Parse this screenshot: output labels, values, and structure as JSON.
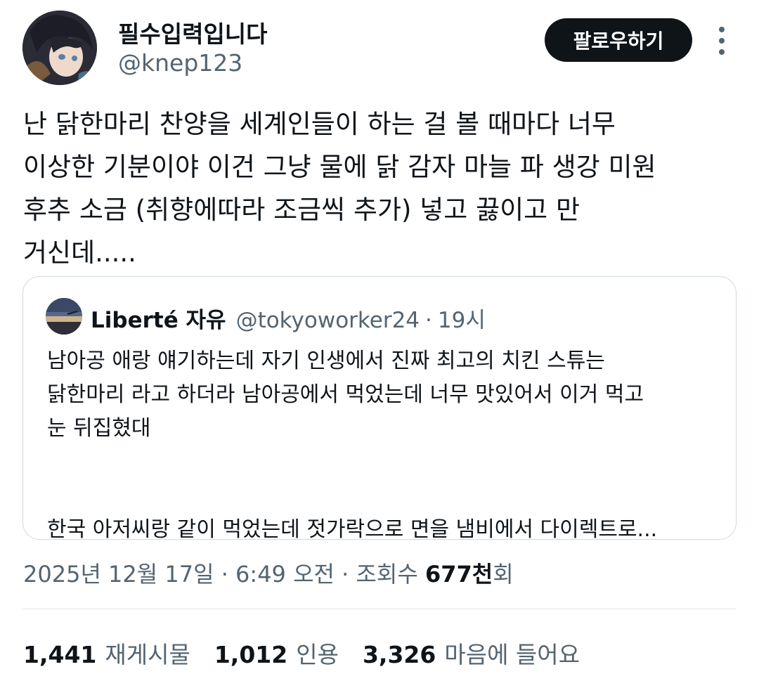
{
  "author": {
    "display_name": "필수입력입니다",
    "handle": "@knep123"
  },
  "actions": {
    "follow_label": "팔로우하기"
  },
  "tweet": {
    "lines": [
      "난 닭한마리 찬양을 세계인들이 하는 걸 볼 때마다 너무",
      "이상한 기분이야 이건 그냥 물에 닭 감자 마늘 파 생강 미원",
      "후추 소금 (취향에따라 조금씩 추가) 넣고 끓이고 만",
      "거신데....."
    ]
  },
  "quote": {
    "name": "Liberté 자유",
    "handle": "@tokyoworker24",
    "separator": "·",
    "time": "19시",
    "lines": [
      "남아공 애랑 얘기하는데 자기 인생에서 진짜 최고의 치킨 스튜는",
      "닭한마리 라고 하더라 남아공에서 먹었는데 너무 맛있어서 이거 먹고",
      "눈 뒤집혔대",
      "한국 아저씨랑 같이 먹었는데 젓가락으로 면을 냄비에서 다이렉트로..."
    ]
  },
  "meta": {
    "timestamp": "2025년 12월 17일 · 6:49 오전 · 조회수 ",
    "views": "677천",
    "views_suffix": "회"
  },
  "stats": {
    "retweets": {
      "count": "1,441",
      "label": "재게시물"
    },
    "quotes": {
      "count": "1,012",
      "label": "인용"
    },
    "likes": {
      "count": "3,326",
      "label": "마음에 들어요"
    }
  },
  "colors": {
    "text_primary": "#0f1419",
    "text_secondary": "#536471",
    "border": "#cfd9de",
    "button_bg": "#0f1419"
  }
}
